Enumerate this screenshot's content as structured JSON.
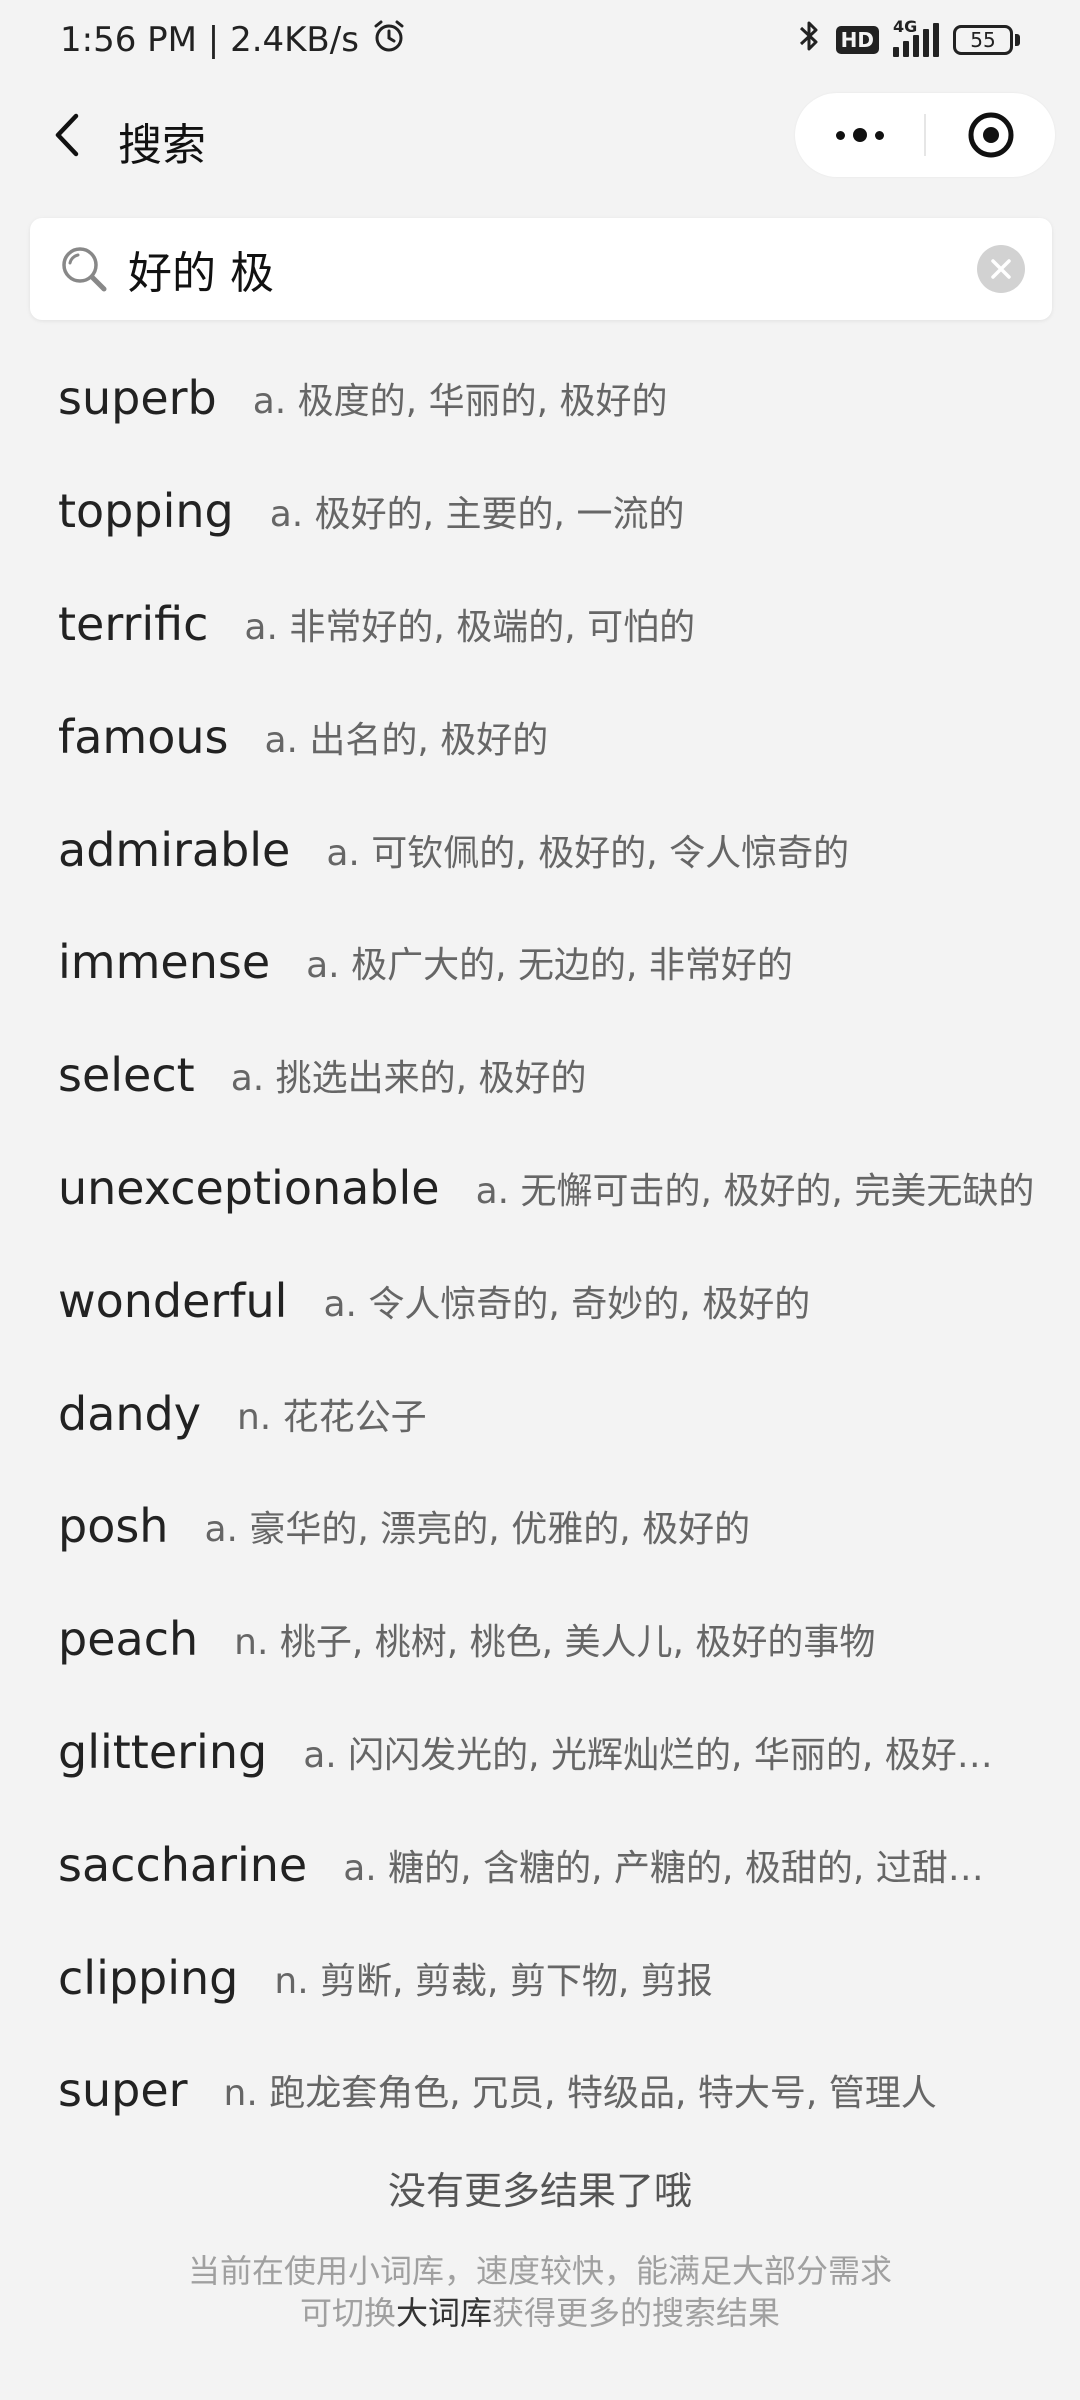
{
  "status_bar": {
    "time_speed": "1:56 PM | 2.4KB/s",
    "network_tag": "4G",
    "hd_badge": "HD",
    "battery": "55"
  },
  "header": {
    "title": "搜索"
  },
  "search": {
    "query": "好的 极"
  },
  "results": [
    {
      "word": "superb",
      "definition": "a. 极度的, 华丽的, 极好的"
    },
    {
      "word": "topping",
      "definition": "a. 极好的, 主要的, 一流的"
    },
    {
      "word": "terrific",
      "definition": "a. 非常好的, 极端的, 可怕的"
    },
    {
      "word": "famous",
      "definition": "a. 出名的, 极好的"
    },
    {
      "word": "admirable",
      "definition": "a. 可钦佩的, 极好的, 令人惊奇的"
    },
    {
      "word": "immense",
      "definition": "a. 极广大的, 无边的, 非常好的"
    },
    {
      "word": "select",
      "definition": "a. 挑选出来的, 极好的"
    },
    {
      "word": "unexceptionable",
      "definition": "a. 无懈可击的, 极好的, 完美无缺的"
    },
    {
      "word": "wonderful",
      "definition": "a. 令人惊奇的, 奇妙的, 极好的"
    },
    {
      "word": "dandy",
      "definition": "n. 花花公子"
    },
    {
      "word": "posh",
      "definition": "a. 豪华的, 漂亮的, 优雅的, 极好的"
    },
    {
      "word": "peach",
      "definition": "n. 桃子, 桃树, 桃色, 美人儿, 极好的事物"
    },
    {
      "word": "glittering",
      "definition": "a. 闪闪发光的, 光辉灿烂的, 华丽的, 极好…"
    },
    {
      "word": "saccharine",
      "definition": "a. 糖的, 含糖的, 产糖的, 极甜的, 过甜…"
    },
    {
      "word": "clipping",
      "definition": "n. 剪断, 剪裁, 剪下物, 剪报"
    },
    {
      "word": "super",
      "definition": "n. 跑龙套角色, 冗员, 特级品, 特大号, 管理人"
    }
  ],
  "footer": {
    "no_more": "没有更多结果了哦",
    "note_line1": "当前在使用小词库，速度较快，能满足大部分需求",
    "note_line2_prefix": "可切换",
    "note_line2_link": "大词库",
    "note_line2_suffix": "获得更多的搜索结果"
  },
  "icons": {
    "bluetooth": "bluetooth-icon",
    "alarm": "alarm-icon",
    "signal": "signal-icon",
    "battery": "battery-icon",
    "back": "chevron-left-icon",
    "more": "more-dots-icon",
    "close_miniprogram": "target-icon",
    "search": "search-icon",
    "clear": "clear-icon"
  }
}
